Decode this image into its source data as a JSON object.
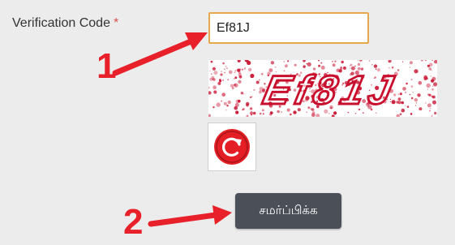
{
  "form": {
    "verification_label": "Verification Code",
    "required_marker": "*",
    "code_value": "Ef81J",
    "captcha_text": "Ef81J",
    "submit_label": "சமர்ப்பிக்க"
  },
  "annotations": {
    "step1": "1",
    "step2": "2"
  },
  "colors": {
    "required": "#d9534f",
    "input_focus_border": "#e5a84b",
    "captcha_text": "#c8102e",
    "refresh_icon": "#e31e24",
    "submit_bg": "#4b4f58",
    "annotation": "#e8202a"
  },
  "icons": {
    "refresh": "refresh-icon"
  }
}
